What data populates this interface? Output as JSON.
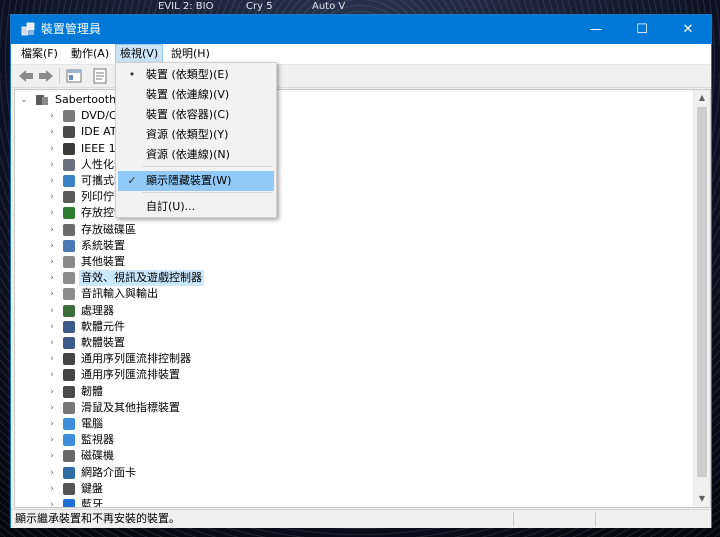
{
  "desktop": {
    "taskbar_labels": [
      "EVIL 2: BIO",
      "Cry 5",
      "Auto V"
    ]
  },
  "window": {
    "title": "裝置管理員",
    "controls": {
      "minimize": "—",
      "maximize": "☐",
      "close": "✕"
    }
  },
  "menubar": {
    "items": [
      "檔案(F)",
      "動作(A)",
      "檢視(V)",
      "說明(H)"
    ]
  },
  "tree": {
    "root": "SabertoothZ",
    "items": [
      {
        "label": "DVD/CD",
        "icon_color": "#7a7a7a"
      },
      {
        "label": "IDE ATA/",
        "icon_color": "#4a4a4a"
      },
      {
        "label": "IEEE 1394",
        "icon_color": "#3a3a3a"
      },
      {
        "label": "人性化介",
        "icon_color": "#6b7280"
      },
      {
        "label": "可攜式裝",
        "icon_color": "#3b82c4"
      },
      {
        "label": "列印佇列",
        "icon_color": "#5a5a5a"
      },
      {
        "label": "存放控制",
        "icon_color": "#2f7d32"
      },
      {
        "label": "存放磁碟區",
        "icon_color": "#6b6b6b"
      },
      {
        "label": "系統裝置",
        "icon_color": "#4a78b5"
      },
      {
        "label": "其他裝置",
        "icon_color": "#8a8a8a"
      },
      {
        "label": "音效、視訊及遊戲控制器",
        "icon_color": "#8c8c8c"
      },
      {
        "label": "音訊輸入與輸出",
        "icon_color": "#8c8c8c"
      },
      {
        "label": "處理器",
        "icon_color": "#3c6e3c"
      },
      {
        "label": "軟體元件",
        "icon_color": "#3c5a8a"
      },
      {
        "label": "軟體裝置",
        "icon_color": "#3c5a8a"
      },
      {
        "label": "通用序列匯流排控制器",
        "icon_color": "#444444"
      },
      {
        "label": "通用序列匯流排裝置",
        "icon_color": "#444444"
      },
      {
        "label": "韌體",
        "icon_color": "#4a4a4a"
      },
      {
        "label": "滑鼠及其他指標裝置",
        "icon_color": "#777777"
      },
      {
        "label": "電腦",
        "icon_color": "#3b8fd9"
      },
      {
        "label": "監視器",
        "icon_color": "#3b8fd9"
      },
      {
        "label": "磁碟機",
        "icon_color": "#666666"
      },
      {
        "label": "網路介面卡",
        "icon_color": "#2e6da4"
      },
      {
        "label": "鍵盤",
        "icon_color": "#555555"
      },
      {
        "label": "藍牙",
        "icon_color": "#1d6fd6"
      }
    ],
    "highlighted": "音效、視訊及遊戲控制器"
  },
  "view_menu": {
    "items": [
      {
        "label": "裝置 (依類型)(E)",
        "mark": "•"
      },
      {
        "label": "裝置 (依連線)(V)",
        "mark": ""
      },
      {
        "label": "裝置 (依容器)(C)",
        "mark": ""
      },
      {
        "label": "資源 (依類型)(Y)",
        "mark": ""
      },
      {
        "label": "資源 (依連線)(N)",
        "mark": ""
      },
      {
        "label": "顯示隱藏裝置(W)",
        "mark": "✓"
      },
      {
        "label": "自訂(U)...",
        "mark": ""
      }
    ]
  },
  "statusbar": {
    "text": "顯示繼承裝置和不再安裝的裝置。"
  },
  "colors": {
    "titlebar": "#0078d7",
    "selection": "#cce8ff",
    "menu_highlight": "#91c9f7"
  }
}
